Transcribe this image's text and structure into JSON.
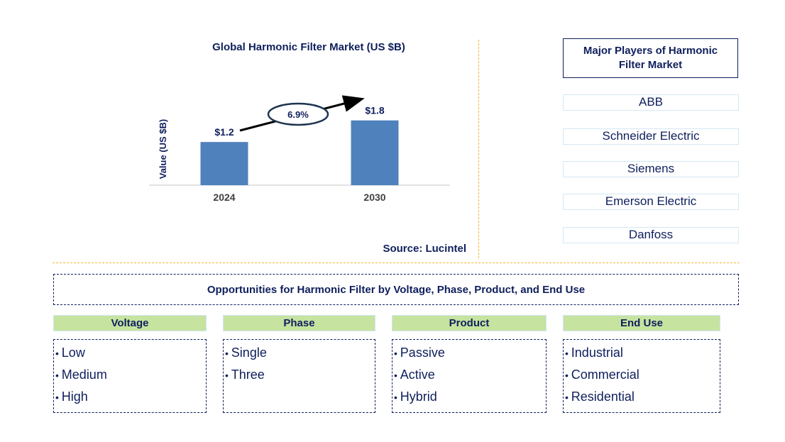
{
  "chart_data": {
    "type": "bar",
    "title": "Global Harmonic Filter Market (US $B)",
    "xlabel": "",
    "ylabel": "Value (US $B)",
    "categories": [
      "2024",
      "2030"
    ],
    "values": [
      1.2,
      1.8
    ],
    "data_labels": [
      "$1.2",
      "$1.8"
    ],
    "ylim": [
      0,
      2.2
    ],
    "grid": false,
    "annotation": {
      "label": "6.9%",
      "meaning": "CAGR 2024-2030"
    },
    "bar_color": "#4f81bd",
    "source": "Source: Lucintel"
  },
  "players": {
    "title": "Major Players of Harmonic Filter Market",
    "items": [
      "ABB",
      "Schneider Electric",
      "Siemens",
      "Emerson Electric",
      "Danfoss"
    ]
  },
  "opportunities": {
    "title": "Opportunities for Harmonic Filter by Voltage, Phase, Product, and End Use",
    "categories": [
      {
        "name": "Voltage",
        "items": [
          "Low",
          "Medium",
          "High"
        ]
      },
      {
        "name": "Phase",
        "items": [
          "Single",
          "Three"
        ]
      },
      {
        "name": "Product",
        "items": [
          "Passive",
          "Active",
          "Hybrid"
        ]
      },
      {
        "name": "End Use",
        "items": [
          "Industrial",
          "Commercial",
          "Residential"
        ]
      }
    ]
  },
  "colors": {
    "text": "#0f1f5c",
    "bar": "#4f81bd",
    "separator": "#f5b82e",
    "category_header": "#c6e3a0"
  }
}
